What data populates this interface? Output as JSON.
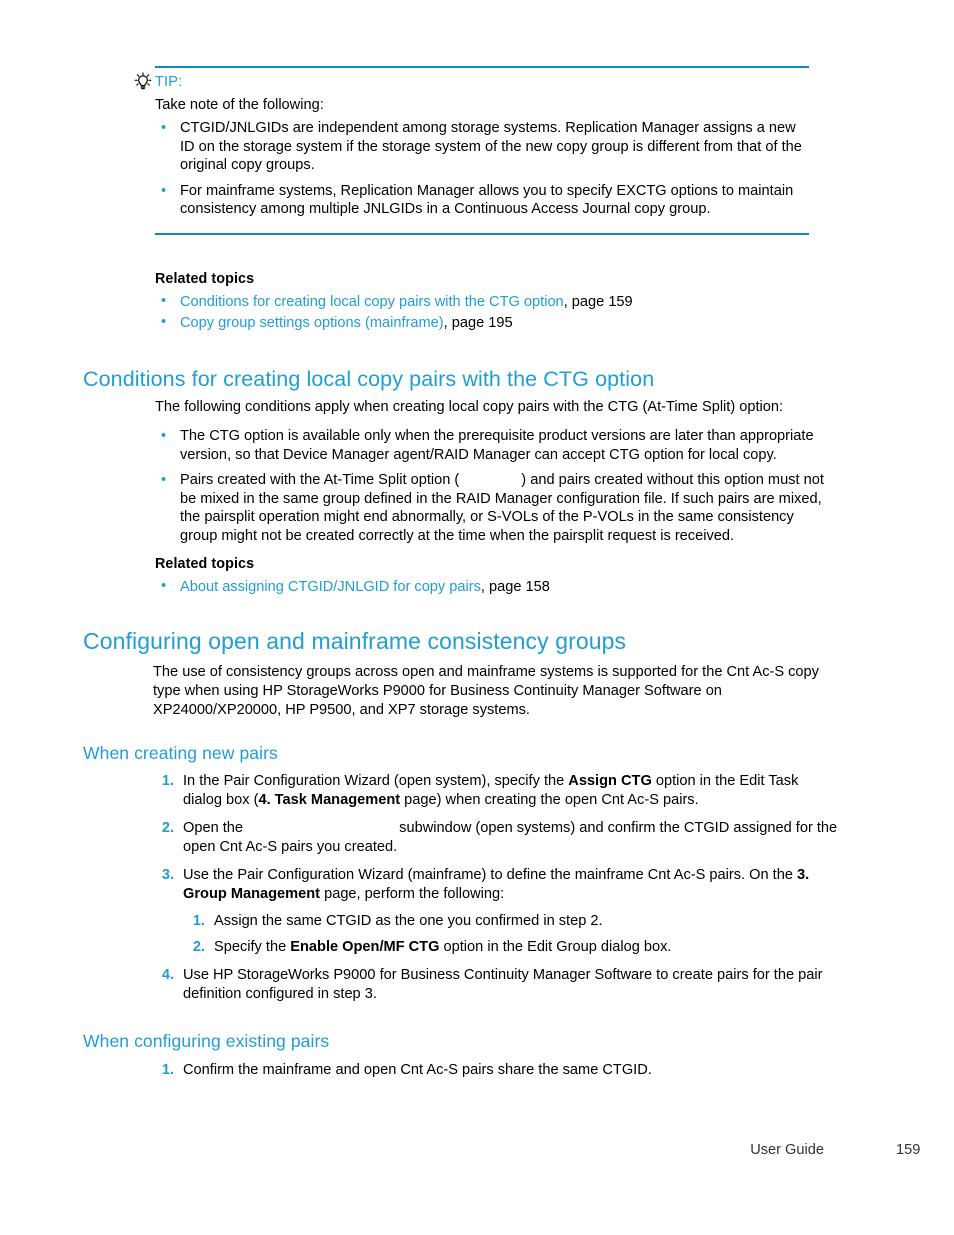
{
  "tip": {
    "icon": "lightbulb-tip-icon",
    "label": "TIP:",
    "intro": "Take note of the following:",
    "bullets": [
      "CTGID/JNLGIDs are independent among storage systems. Replication Manager assigns a new ID on the storage system if the storage system of the new copy group is different from that of the original copy groups.",
      "For mainframe systems, Replication Manager allows you to specify EXCTG options to maintain consistency among multiple JNLGIDs in a Continuous Access Journal copy group."
    ]
  },
  "related_topics_1": {
    "title": "Related topics",
    "items": [
      {
        "link": "Conditions for creating local copy pairs with the CTG option",
        "page": ", page 159"
      },
      {
        "link": "Copy group settings options (mainframe)",
        "page": ", page 195"
      }
    ]
  },
  "section_conditions": {
    "heading": "Conditions for creating local copy pairs with the CTG option",
    "intro": "The following conditions apply when creating local copy pairs with the CTG (At-Time Split) option:",
    "bullets": [
      {
        "parts": [
          {
            "type": "text",
            "value": "The CTG option is available only when the prerequisite product versions are later than appropriate version, so that Device Manager agent/RAID Manager can accept CTG option for local copy."
          }
        ]
      },
      {
        "parts": [
          {
            "type": "text",
            "value": "Pairs created with the At-Time Split option ("
          },
          {
            "type": "gap",
            "value": ""
          },
          {
            "type": "text",
            "value": ") and pairs created without this option must not be mixed in the same group defined in the RAID Manager configuration file. If such pairs are mixed, the pairsplit operation might end abnormally, or S-VOLs of the P-VOLs in the same consistency group might not be created correctly at the time when the pairsplit request is received."
          }
        ]
      }
    ]
  },
  "related_topics_2": {
    "title": "Related topics",
    "items": [
      {
        "link": "About assigning CTGID/JNLGID for copy pairs",
        "page": ", page 158"
      }
    ]
  },
  "section_configuring": {
    "heading": "Configuring open and mainframe consistency groups",
    "intro": "The use of consistency groups across open and mainframe systems is supported for the Cnt Ac-S copy type when using HP StorageWorks P9000 for Business Continuity Manager Software on XP24000/XP20000, HP P9500, and XP7 storage systems."
  },
  "section_creating": {
    "heading": "When creating new pairs",
    "steps": [
      {
        "number": "1.",
        "text_1": "In the Pair Configuration Wizard (open system), specify the ",
        "bold_1": "Assign CTG",
        "text_2": " option in the Edit Task dialog box (",
        "bold_2": "4. Task Management",
        "text_3": " page) when creating the open Cnt Ac-S pairs."
      },
      {
        "number": "2.",
        "text_1": "Open the ",
        "gap": "",
        "text_2": " subwindow (open systems) and confirm the CTGID assigned for the open Cnt Ac-S pairs you created."
      },
      {
        "number": "3.",
        "text_1": "Use the Pair Configuration Wizard (mainframe) to define the mainframe Cnt Ac-S pairs. On the ",
        "bold_1": "3. Group Management",
        "text_2": " page, perform the following:",
        "substeps": [
          {
            "number": "1.",
            "text_1": "Assign the same CTGID as the one you confirmed in step 2.",
            "bold_1": "",
            "text_2": ""
          },
          {
            "number": "2.",
            "text_1": "Specify the ",
            "bold_1": "Enable Open/MF CTG",
            "text_2": "  option in the Edit Group dialog box."
          }
        ]
      },
      {
        "number": "4.",
        "text_1": "Use HP StorageWorks P9000 for Business Continuity Manager Software to create pairs for the pair definition configured in step 3."
      }
    ]
  },
  "section_existing": {
    "heading": "When configuring existing pairs",
    "steps": [
      {
        "number": "1.",
        "text_1": "Confirm the mainframe and open Cnt Ac-S pairs share the same CTGID."
      }
    ]
  },
  "footer": {
    "guide_label": "User Guide",
    "page_number": "159"
  },
  "colors": {
    "accent_blue": "#1f9ed4",
    "rule_blue": "#1388c0",
    "body_text": "#000000"
  }
}
